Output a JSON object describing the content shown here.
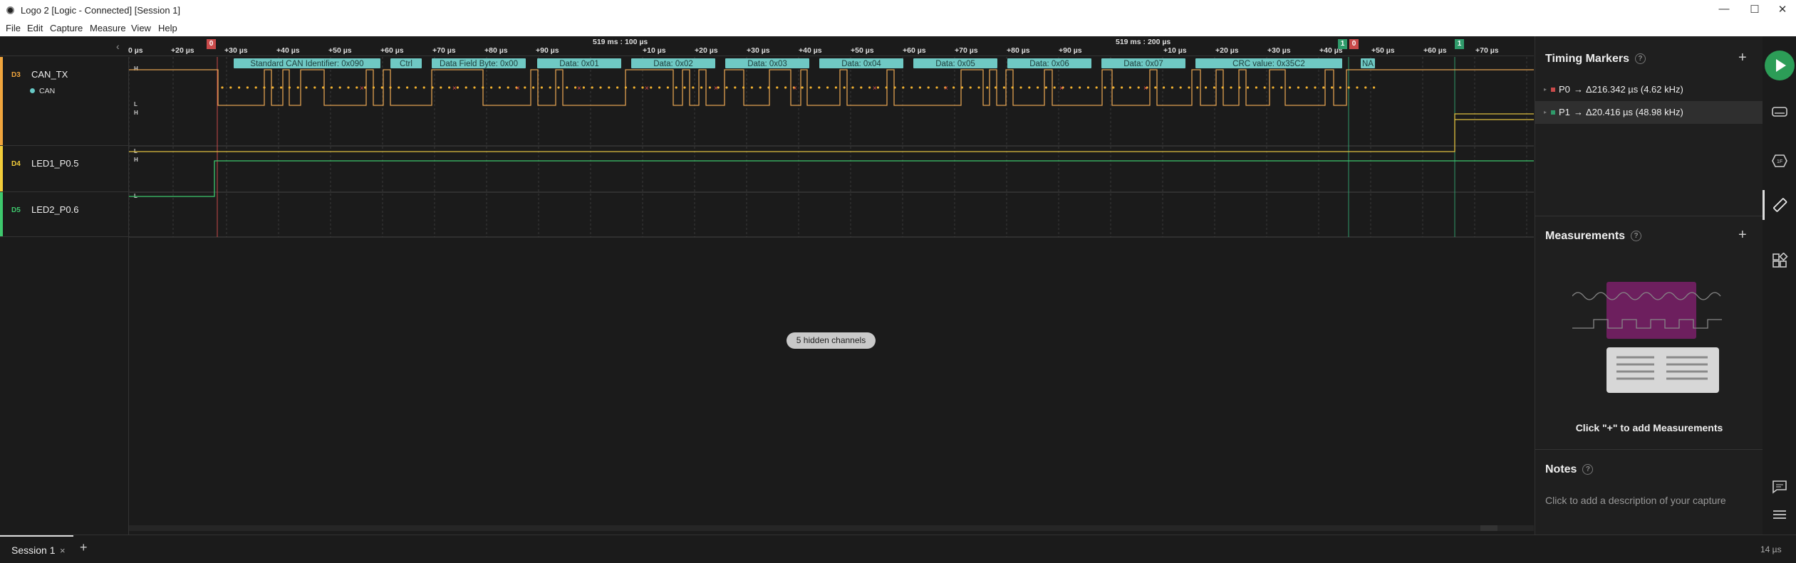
{
  "window": {
    "title": "Logo 2 [Logic - Connected] [Session 1]",
    "min": "—",
    "max": "☐",
    "close": "✕"
  },
  "menu": [
    "File",
    "Edit",
    "Capture",
    "Measure",
    "View",
    "Help"
  ],
  "ruler": {
    "collapse": "‹",
    "group_a": "519 ms : 100 µs",
    "group_b": "519 ms : 200 µs",
    "ticks_a": [
      "0 µs",
      "+20 µs",
      "+30 µs",
      "+40 µs",
      "+50 µs",
      "+60 µs",
      "+70 µs",
      "+80 µs",
      "+90 µs",
      "+10 µs",
      "+20 µs",
      "+30 µs",
      "+40 µs",
      "+50 µs",
      "+60 µs",
      "+70 µs",
      "+80 µs",
      "+90 µs",
      "+10 µs",
      "+20 µs",
      "+30 µs",
      "+40 µs",
      "+50 µs",
      "+60 µs",
      "+70 µs"
    ],
    "marker_p0": "0",
    "marker_p1": "1"
  },
  "channels": [
    {
      "num": "D3",
      "name": "CAN_TX",
      "color": "#f0a53d",
      "analyzer": "CAN"
    },
    {
      "num": "D4",
      "name": "LED1_P0.5",
      "color": "#f2cc3a"
    },
    {
      "num": "D5",
      "name": "LED2_P0.6",
      "color": "#3ec86d"
    }
  ],
  "levels": {
    "high": "H",
    "low": "L"
  },
  "can_frames": [
    "Standard CAN Identifier: 0x090",
    "Ctrl",
    "Data Field Byte: 0x00",
    "Data: 0x01",
    "Data: 0x02",
    "Data: 0x03",
    "Data: 0x04",
    "Data: 0x05",
    "Data: 0x06",
    "Data: 0x07",
    "CRC value: 0x35C2",
    "NA"
  ],
  "hidden_channels": "5 hidden channels",
  "timing_markers": {
    "title": "Timing Markers",
    "help": "?",
    "add": "+",
    "rows": [
      {
        "name": "P0",
        "arrow": "→",
        "value": "Δ216.342 µs (4.62 kHz)",
        "color": "#c94a4a"
      },
      {
        "name": "P1",
        "arrow": "→",
        "value": "Δ20.416 µs (48.98 kHz)",
        "color": "#2f9a6a"
      }
    ]
  },
  "measurements": {
    "title": "Measurements",
    "help": "?",
    "add": "+",
    "empty_text": "Click \"+\" to add Measurements"
  },
  "notes": {
    "title": "Notes",
    "help": "?",
    "placeholder": "Click to add a description of your capture"
  },
  "session": {
    "tab": "Session 1",
    "close": "×",
    "add": "+"
  },
  "zoom": "14 µs"
}
